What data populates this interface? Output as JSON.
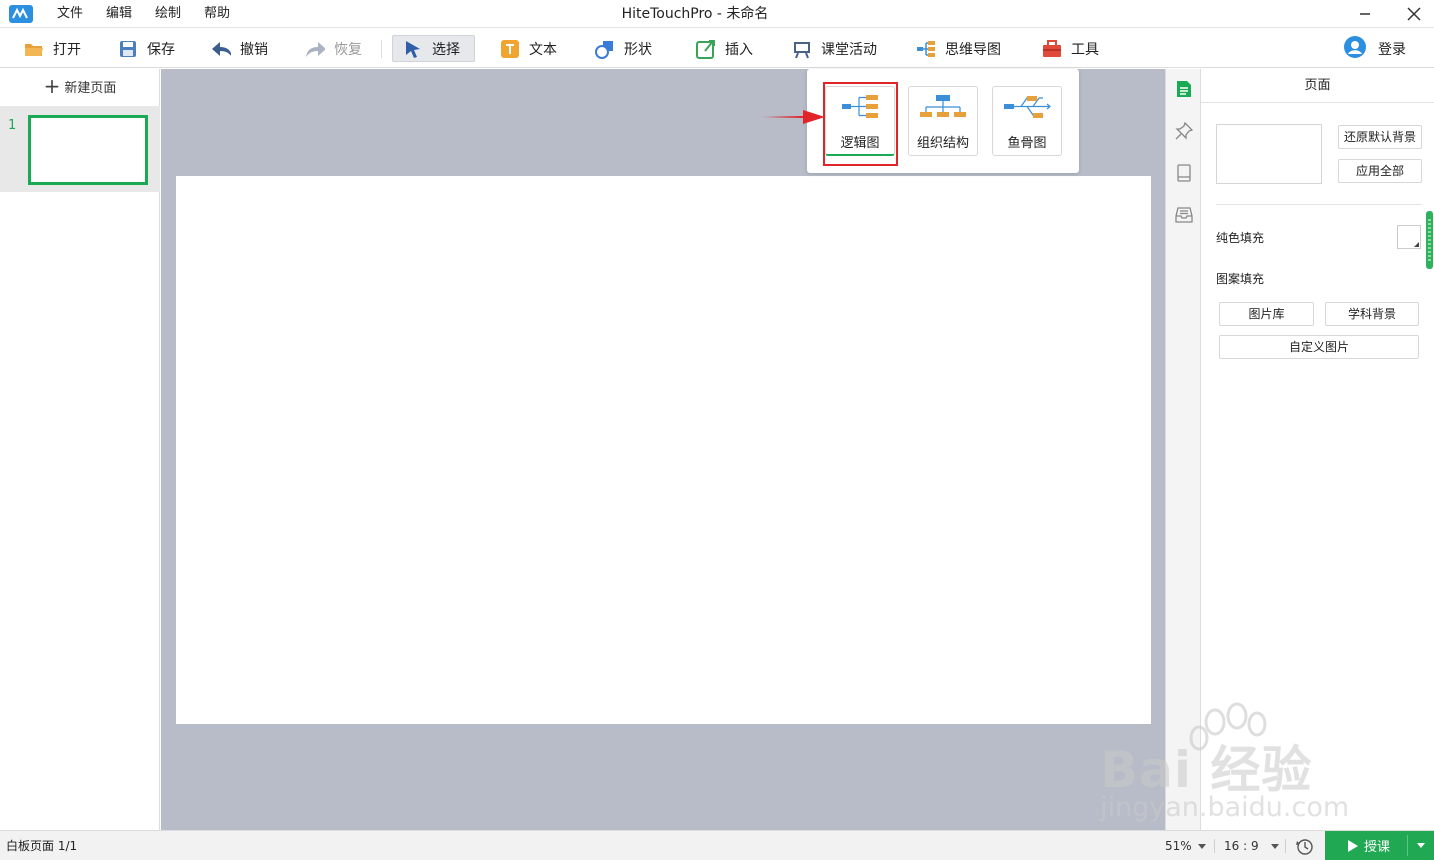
{
  "window": {
    "title": "HiteTouchPro - 未命名"
  },
  "menu": [
    "文件",
    "编辑",
    "绘制",
    "帮助"
  ],
  "toolbar": {
    "open": "打开",
    "save": "保存",
    "undo": "撤销",
    "redo": "恢复",
    "select": "选择",
    "text": "文本",
    "shape": "形状",
    "insert": "插入",
    "classroom": "课堂活动",
    "mindmap": "思维导图",
    "tools": "工具",
    "login": "登录"
  },
  "pages_panel": {
    "new_page": "新建页面",
    "pages": [
      {
        "number": "1"
      }
    ]
  },
  "mindmap_popup": {
    "items": [
      {
        "label": "逻辑图",
        "icon": "logic-diagram-icon",
        "selected": true
      },
      {
        "label": "组织结构",
        "icon": "org-chart-icon",
        "selected": false
      },
      {
        "label": "鱼骨图",
        "icon": "fishbone-icon",
        "selected": false
      }
    ]
  },
  "properties": {
    "title": "页面",
    "restore_default_bg": "还原默认背景",
    "apply_all": "应用全部",
    "solid_fill": "纯色填充",
    "pattern_fill": "图案填充",
    "image_library": "图片库",
    "subject_bg": "学科背景",
    "custom_image": "自定义图片"
  },
  "statusbar": {
    "page_info": "白板页面 1/1",
    "zoom": "51%",
    "ratio": "16 : 9",
    "teach": "授课"
  },
  "watermark": {
    "line1": "Bai 经验",
    "line2": "jingyan.baidu.com"
  },
  "colors": {
    "accent_green": "#1aaa55",
    "canvas_gray": "#b7bcc8",
    "highlight_red": "#e0242a"
  }
}
